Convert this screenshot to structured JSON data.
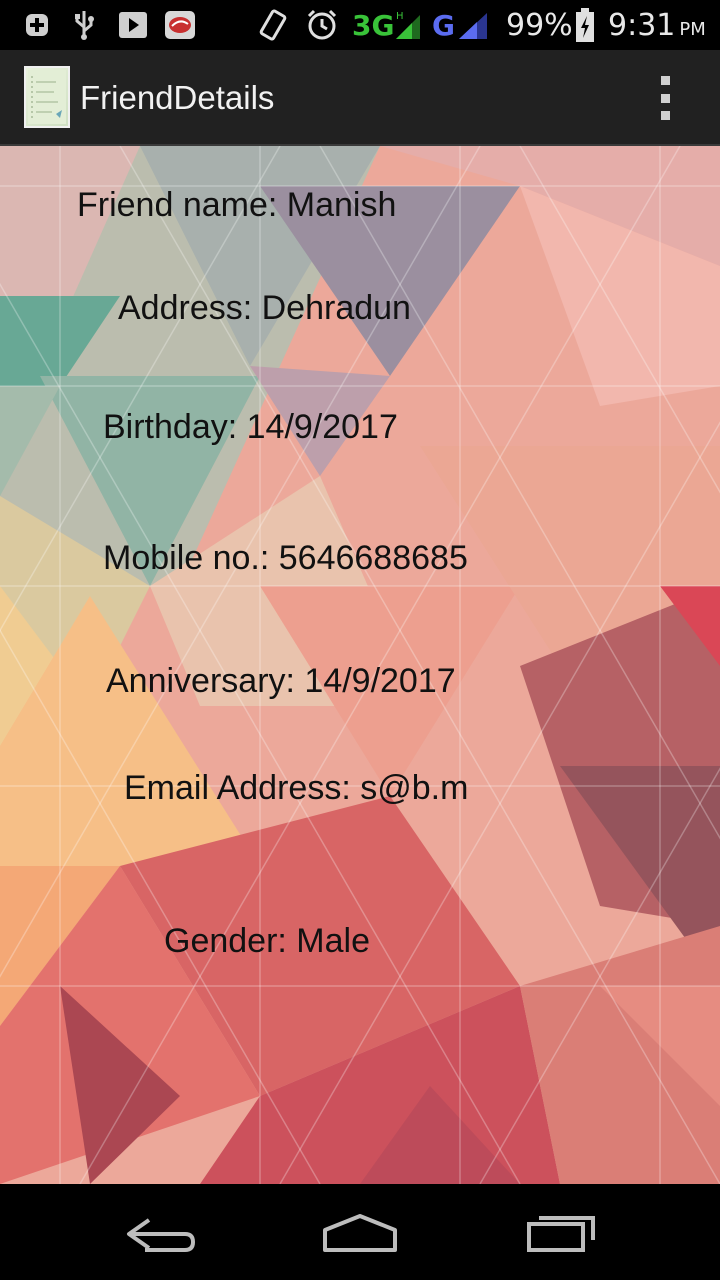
{
  "status_bar": {
    "icons": [
      "plus-icon",
      "usb-icon",
      "play-store-icon",
      "app-notification-icon",
      "vibrate-icon",
      "alarm-icon",
      "signal-icon",
      "battery-icon"
    ],
    "network_1": "3G",
    "network_2": "G",
    "battery": "99%",
    "time": "9:31",
    "ampm": "PM"
  },
  "action_bar": {
    "title": "FriendDetails",
    "overflow_icon": "overflow-menu-icon"
  },
  "details": {
    "friend_name": "Friend name: Manish",
    "address": "Address: Dehradun",
    "birthday": "Birthday: 14/9/2017",
    "mobile": "Mobile no.: 5646688685",
    "anniversary": "Anniversary: 14/9/2017",
    "email": "Email Address: s@b.m",
    "gender": "Gender: Male"
  },
  "nav_bar": {
    "icons": [
      "back-icon",
      "home-icon",
      "recents-icon"
    ]
  }
}
